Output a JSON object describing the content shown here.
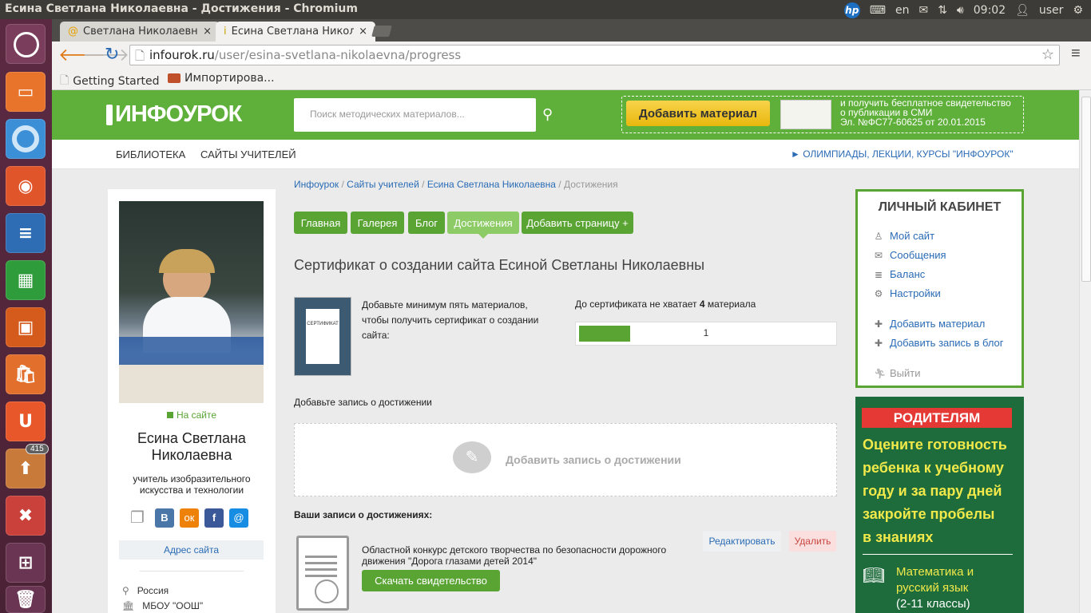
{
  "topbar": {
    "window_title": "Есина Светлана Николаевна - Достижения - Chromium",
    "lang": "en",
    "time": "09:02",
    "user": "user"
  },
  "launcher": {
    "badge_count": "415"
  },
  "browser": {
    "tabs": [
      {
        "label": "Светлана Николаевна, м"
      },
      {
        "label": "Есина Светлана Николае"
      }
    ],
    "url_host": "infourok.ru",
    "url_path": "/user/esina-svetlana-nikolaevna/progress",
    "bookmarks": [
      {
        "label": "Getting Started"
      },
      {
        "label": "Импортирова..."
      }
    ]
  },
  "site": {
    "logo_part1": "ИНФО",
    "logo_part2": "УРОК",
    "search_placeholder": "Поиск методических материалов...",
    "add_material_btn": "Добавить материал",
    "promo_line1": "и получить бесплатное свидетельство",
    "promo_line2": "о публикации в СМИ",
    "promo_line3": "Эл. №ФС77-60625 от 20.01.2015",
    "nav": {
      "library": "БИБЛИОТЕКА",
      "teacher_sites": "САЙТЫ УЧИТЕЛЕЙ",
      "olympiads": "► ОЛИМПИАДЫ, ЛЕКЦИИ, КУРСЫ \"ИНФОУРОК\""
    }
  },
  "profile": {
    "status": "На сайте",
    "name_line1": "Есина Светлана",
    "name_line2": "Николаевна",
    "role_line1": "учитель изобразительного",
    "role_line2": "искусства и технологии",
    "site_address_btn": "Адрес сайта",
    "country": "Россия",
    "school": "МБОУ \"ООШ\""
  },
  "breadcrumb": {
    "item1": "Инфоурок",
    "item2": "Сайты учителей",
    "item3": "Есина Светлана Николаевна",
    "current": "Достижения",
    "sep": "/"
  },
  "page_tabs": [
    {
      "label": "Главная"
    },
    {
      "label": "Галерея"
    },
    {
      "label": "Блог"
    },
    {
      "label": "Достижения"
    },
    {
      "label": "Добавить страницу +"
    }
  ],
  "certificate": {
    "heading": "Сертификат о создании сайта Есиной Светланы Николаевны",
    "thumb_label": "СЕРТИФИКАТ",
    "instruction_line1": "Добавьте минимум пять материалов,",
    "instruction_line2": "чтобы получить сертификат о создании",
    "instruction_line3": "сайта:",
    "missing_prefix": "До сертификата не хватает",
    "missing_count": "4",
    "missing_suffix": "материала",
    "progress_value": "1",
    "progress_fraction": 0.2
  },
  "achievement": {
    "add_prompt": "Добавьте запись о достижении",
    "add_button": "Добавить запись о достижении",
    "your_records": "Ваши записи о достижениях:",
    "record_line1": "Областной конкурс детского творчества по безопасности дорожного",
    "record_line2": "движения \"Дорога глазами детей 2014\"",
    "download_btn": "Скачать свидетельство",
    "edit_btn": "Редактировать",
    "delete_btn": "Удалить"
  },
  "cabinet": {
    "title": "ЛИЧНЫЙ КАБИНЕТ",
    "my_site": "Мой сайт",
    "messages": "Сообщения",
    "balance": "Баланс",
    "settings": "Настройки",
    "add_material": "Добавить материал",
    "add_blog": "Добавить запись в блог",
    "logout": "Выйти"
  },
  "ad": {
    "badge": "РОДИТЕЛЯМ",
    "line1": "Оцените готовность",
    "line2": "ребенка к учебному",
    "line3": "году и за пару дней",
    "line4": "закройте пробелы",
    "line5": "в знаниях",
    "subject_line1": "Математика и",
    "subject_line2": "русский язык",
    "subject_line3": "(2-11 классы)"
  },
  "colors": {
    "brand_green": "#5fb03a",
    "button_green": "#5aa434",
    "add_yellow": "#f2c11a",
    "link_blue": "#2a6bb5",
    "ad_bg": "#1e6b3c",
    "ad_red": "#e53935"
  }
}
